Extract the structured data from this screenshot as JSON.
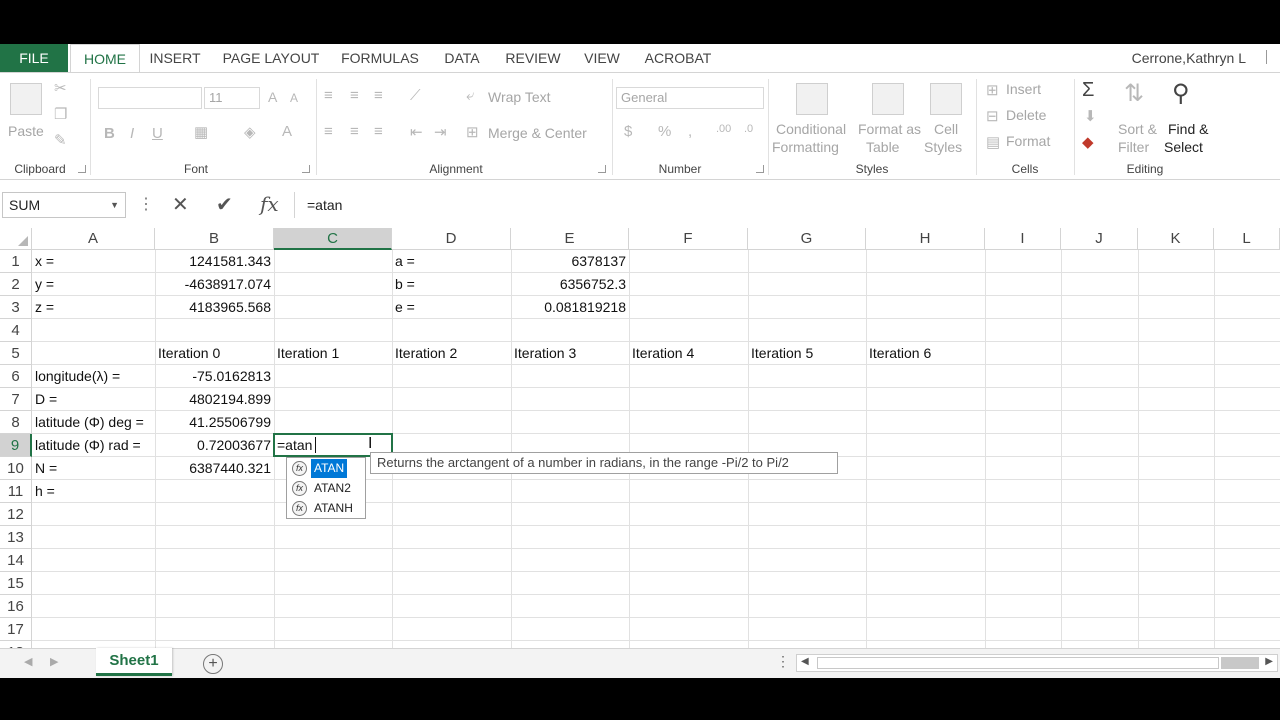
{
  "tabs": [
    "FILE",
    "HOME",
    "INSERT",
    "PAGE LAYOUT",
    "FORMULAS",
    "DATA",
    "REVIEW",
    "VIEW",
    "ACROBAT"
  ],
  "user": "Cerrone,Kathryn L",
  "ribbon": {
    "clipboard": {
      "paste": "Paste",
      "label": "Clipboard"
    },
    "font": {
      "size": "11",
      "label": "Font"
    },
    "alignment": {
      "wrap": "Wrap Text",
      "merge": "Merge & Center",
      "label": "Alignment"
    },
    "number": {
      "format": "General",
      "label": "Number"
    },
    "styles": {
      "cond1": "Conditional",
      "cond2": "Formatting",
      "fmt1": "Format as",
      "fmt2": "Table",
      "cell1": "Cell",
      "cell2": "Styles",
      "label": "Styles"
    },
    "cells": {
      "insert": "Insert",
      "delete": "Delete",
      "format": "Format",
      "label": "Cells"
    },
    "editing": {
      "sort1": "Sort &",
      "sort2": "Filter",
      "find1": "Find &",
      "find2": "Select",
      "label": "Editing"
    }
  },
  "formula_bar": {
    "name_box": "SUM",
    "formula": "=atan"
  },
  "columns": [
    "A",
    "B",
    "C",
    "D",
    "E",
    "F",
    "G",
    "H",
    "I",
    "J",
    "K",
    "L"
  ],
  "rows": [
    "1",
    "2",
    "3",
    "4",
    "5",
    "6",
    "7",
    "8",
    "9",
    "10",
    "11",
    "12",
    "13",
    "14",
    "15",
    "16",
    "17",
    "18"
  ],
  "cells": {
    "A1": "x =",
    "B1": "1241581.343",
    "D1": "a =",
    "E1": "6378137",
    "A2": "y =",
    "B2": "-4638917.074",
    "D2": "b =",
    "E2": "6356752.3",
    "A3": "z =",
    "B3": "4183965.568",
    "D3": "e =",
    "E3": "0.081819218",
    "B5": "Iteration 0",
    "C5": "Iteration 1",
    "D5": "Iteration 2",
    "E5": "Iteration 3",
    "F5": "Iteration 4",
    "G5": "Iteration 5",
    "H5": "Iteration 6",
    "A6": "longitude(λ) =",
    "B6": "-75.0162813",
    "A7": "D =",
    "B7": "4802194.899",
    "A8": "latitude (Φ) deg =",
    "B8": "41.25506799",
    "A9": "latitude (Φ) rad =",
    "B9": "0.72003677",
    "A10": "N =",
    "B10": "6387440.321",
    "A11": "h ="
  },
  "active_cell": {
    "ref": "C9",
    "value": "=atan"
  },
  "autocomplete": {
    "items": [
      "ATAN",
      "ATAN2",
      "ATANH"
    ],
    "tooltip": "Returns the arctangent of a number in radians, in the range -Pi/2 to Pi/2"
  },
  "sheet": {
    "name": "Sheet1"
  },
  "colors": {
    "accent": "#217346",
    "selection": "#0078d7"
  }
}
